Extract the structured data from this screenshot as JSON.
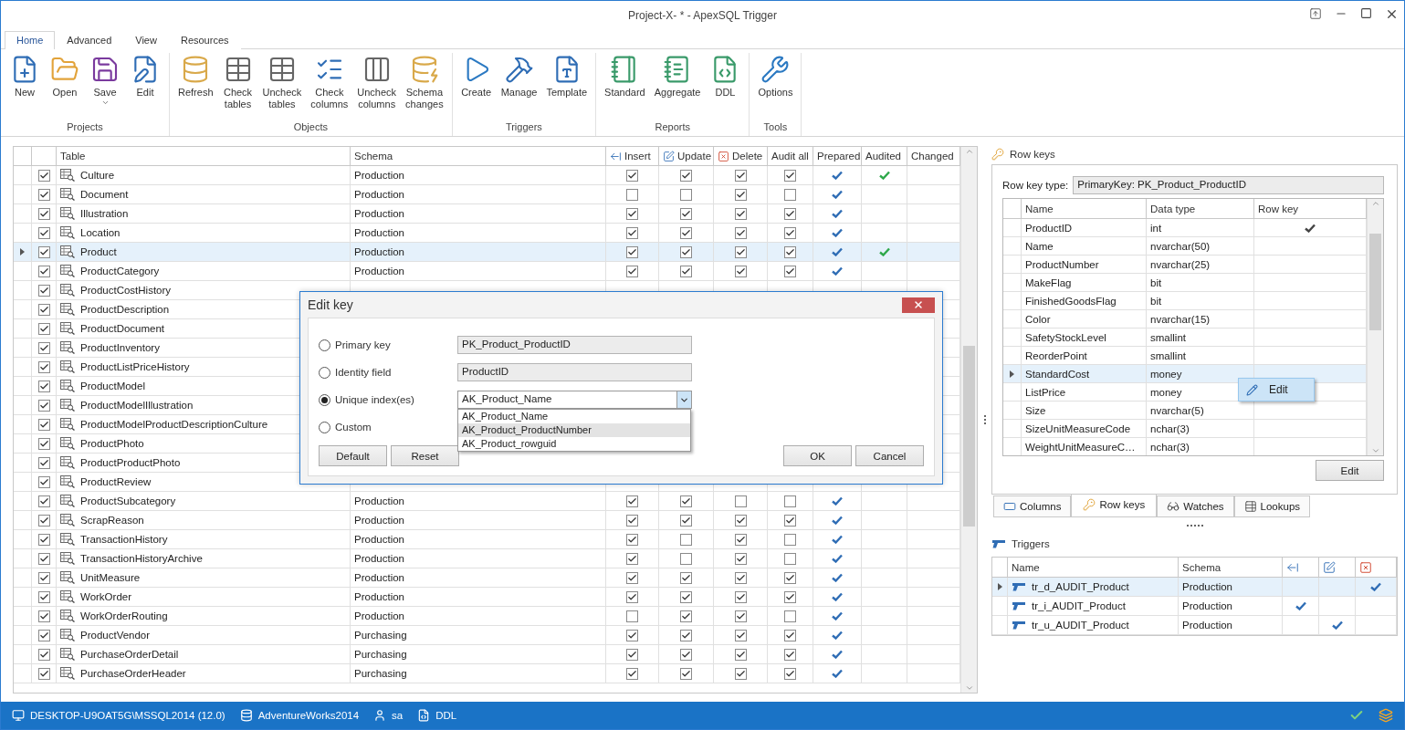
{
  "window": {
    "title": "Project-X- * - ApexSQL Trigger"
  },
  "ribbon_tabs": [
    {
      "label": "Home",
      "selected": true
    },
    {
      "label": "Advanced",
      "selected": false
    },
    {
      "label": "View",
      "selected": false
    },
    {
      "label": "Resources",
      "selected": false
    }
  ],
  "ribbon_groups": [
    {
      "label": "Projects",
      "buttons": [
        {
          "label": "New",
          "kind": "plain"
        },
        {
          "label": "Open",
          "kind": "plain"
        },
        {
          "label": "Save",
          "kind": "dropdown"
        },
        {
          "label": "Edit",
          "kind": "plain"
        }
      ]
    },
    {
      "label": "Objects",
      "buttons": [
        {
          "label": "Refresh",
          "kind": "plain"
        },
        {
          "label": "Check tables",
          "kind": "plain"
        },
        {
          "label": "Uncheck tables",
          "kind": "plain"
        },
        {
          "label": "Check columns",
          "kind": "plain"
        },
        {
          "label": "Uncheck columns",
          "kind": "plain"
        },
        {
          "label": "Schema changes",
          "kind": "plain"
        }
      ]
    },
    {
      "label": "Triggers",
      "buttons": [
        {
          "label": "Create",
          "kind": "plain"
        },
        {
          "label": "Manage",
          "kind": "plain"
        },
        {
          "label": "Template",
          "kind": "plain"
        }
      ]
    },
    {
      "label": "Reports",
      "buttons": [
        {
          "label": "Standard",
          "kind": "plain"
        },
        {
          "label": "Aggregate",
          "kind": "plain"
        },
        {
          "label": "DDL",
          "kind": "plain"
        }
      ]
    },
    {
      "label": "Tools",
      "buttons": [
        {
          "label": "Options",
          "kind": "plain"
        }
      ]
    }
  ],
  "table": {
    "columns": [
      {
        "label": "Table"
      },
      {
        "label": "Schema"
      },
      {
        "label": "Insert"
      },
      {
        "label": "Update"
      },
      {
        "label": "Delete"
      },
      {
        "label": "Audit all"
      },
      {
        "label": "Prepared"
      },
      {
        "label": "Audited"
      },
      {
        "label": "Changed"
      }
    ],
    "rows": [
      {
        "selected": false,
        "included": true,
        "name": "Culture",
        "schema": "Production",
        "insert": true,
        "update": true,
        "delete": true,
        "audit_all": true,
        "prepared": true,
        "audited": true
      },
      {
        "selected": false,
        "included": true,
        "name": "Document",
        "schema": "Production",
        "insert": false,
        "update": false,
        "delete": true,
        "audit_all": false,
        "prepared": true,
        "audited": false
      },
      {
        "selected": false,
        "included": true,
        "name": "Illustration",
        "schema": "Production",
        "insert": true,
        "update": true,
        "delete": true,
        "audit_all": true,
        "prepared": true,
        "audited": false
      },
      {
        "selected": false,
        "included": true,
        "name": "Location",
        "schema": "Production",
        "insert": true,
        "update": true,
        "delete": true,
        "audit_all": true,
        "prepared": true,
        "audited": false
      },
      {
        "selected": true,
        "included": true,
        "name": "Product",
        "schema": "Production",
        "insert": true,
        "update": true,
        "delete": true,
        "audit_all": true,
        "prepared": true,
        "audited": true
      },
      {
        "selected": false,
        "included": true,
        "name": "ProductCategory",
        "schema": "Production",
        "insert": true,
        "update": true,
        "delete": true,
        "audit_all": true,
        "prepared": true,
        "audited": false
      },
      {
        "selected": false,
        "included": true,
        "name": "ProductCostHistory"
      },
      {
        "selected": false,
        "included": true,
        "name": "ProductDescription"
      },
      {
        "selected": false,
        "included": true,
        "name": "ProductDocument"
      },
      {
        "selected": false,
        "included": true,
        "name": "ProductInventory"
      },
      {
        "selected": false,
        "included": true,
        "name": "ProductListPriceHistory"
      },
      {
        "selected": false,
        "included": true,
        "name": "ProductModel"
      },
      {
        "selected": false,
        "included": true,
        "name": "ProductModelIllustration"
      },
      {
        "selected": false,
        "included": true,
        "name": "ProductModelProductDescriptionCulture"
      },
      {
        "selected": false,
        "included": true,
        "name": "ProductPhoto"
      },
      {
        "selected": false,
        "included": true,
        "name": "ProductProductPhoto"
      },
      {
        "selected": false,
        "included": true,
        "name": "ProductReview"
      },
      {
        "selected": false,
        "included": true,
        "name": "ProductSubcategory",
        "schema": "Production",
        "insert": true,
        "update": true,
        "delete": false,
        "audit_all": false,
        "prepared": true,
        "audited": false
      },
      {
        "selected": false,
        "included": true,
        "name": "ScrapReason",
        "schema": "Production",
        "insert": true,
        "update": true,
        "delete": true,
        "audit_all": true,
        "prepared": true,
        "audited": false
      },
      {
        "selected": false,
        "included": true,
        "name": "TransactionHistory",
        "schema": "Production",
        "insert": true,
        "update": false,
        "delete": true,
        "audit_all": false,
        "prepared": true,
        "audited": false
      },
      {
        "selected": false,
        "included": true,
        "name": "TransactionHistoryArchive",
        "schema": "Production",
        "insert": true,
        "update": false,
        "delete": true,
        "audit_all": false,
        "prepared": true,
        "audited": false
      },
      {
        "selected": false,
        "included": true,
        "name": "UnitMeasure",
        "schema": "Production",
        "insert": true,
        "update": true,
        "delete": true,
        "audit_all": true,
        "prepared": true,
        "audited": false
      },
      {
        "selected": false,
        "included": true,
        "name": "WorkOrder",
        "schema": "Production",
        "insert": true,
        "update": true,
        "delete": true,
        "audit_all": true,
        "prepared": true,
        "audited": false
      },
      {
        "selected": false,
        "included": true,
        "name": "WorkOrderRouting",
        "schema": "Production",
        "insert": false,
        "update": true,
        "delete": true,
        "audit_all": false,
        "prepared": true,
        "audited": false
      },
      {
        "selected": false,
        "included": true,
        "name": "ProductVendor",
        "schema": "Purchasing",
        "insert": true,
        "update": true,
        "delete": true,
        "audit_all": true,
        "prepared": true,
        "audited": false
      },
      {
        "selected": false,
        "included": true,
        "name": "PurchaseOrderDetail",
        "schema": "Purchasing",
        "insert": true,
        "update": true,
        "delete": true,
        "audit_all": true,
        "prepared": true,
        "audited": false
      },
      {
        "selected": false,
        "included": true,
        "name": "PurchaseOrderHeader",
        "schema": "Purchasing",
        "insert": true,
        "update": true,
        "delete": true,
        "audit_all": true,
        "prepared": true,
        "audited": false
      }
    ]
  },
  "dialog": {
    "title": "Edit key",
    "options": [
      {
        "label": "Primary key",
        "selected": false,
        "kind": "text",
        "value": "PK_Product_ProductID"
      },
      {
        "label": "Identity field",
        "selected": false,
        "kind": "text",
        "value": "ProductID"
      },
      {
        "label": "Unique index(es)",
        "selected": true,
        "kind": "combo",
        "value": "AK_Product_Name",
        "items": [
          {
            "label": "AK_Product_Name",
            "highlighted": false
          },
          {
            "label": "AK_Product_ProductNumber",
            "highlighted": true
          },
          {
            "label": "AK_Product_rowguid",
            "highlighted": false
          }
        ]
      },
      {
        "label": "Custom",
        "selected": false,
        "kind": "none"
      }
    ],
    "left_buttons": [
      "Default",
      "Reset"
    ],
    "right_buttons": [
      "OK",
      "Cancel"
    ]
  },
  "row_keys": {
    "title": "Row keys",
    "key_type_label": "Row key type:",
    "key_type_value": "PrimaryKey: PK_Product_ProductID",
    "columns": [
      "Name",
      "Data type",
      "Row key"
    ],
    "rows": [
      {
        "name": "ProductID",
        "data_type": "int",
        "row_key": true,
        "selected": false
      },
      {
        "name": "Name",
        "data_type": "nvarchar(50)",
        "row_key": false,
        "selected": false
      },
      {
        "name": "ProductNumber",
        "data_type": "nvarchar(25)",
        "row_key": false,
        "selected": false
      },
      {
        "name": "MakeFlag",
        "data_type": "bit",
        "row_key": false,
        "selected": false
      },
      {
        "name": "FinishedGoodsFlag",
        "data_type": "bit",
        "row_key": false,
        "selected": false
      },
      {
        "name": "Color",
        "data_type": "nvarchar(15)",
        "row_key": false,
        "selected": false
      },
      {
        "name": "SafetyStockLevel",
        "data_type": "smallint",
        "row_key": false,
        "selected": false
      },
      {
        "name": "ReorderPoint",
        "data_type": "smallint",
        "row_key": false,
        "selected": false
      },
      {
        "name": "StandardCost",
        "data_type": "money",
        "row_key": false,
        "selected": true
      },
      {
        "name": "ListPrice",
        "data_type": "money",
        "row_key": false,
        "selected": false
      },
      {
        "name": "Size",
        "data_type": "nvarchar(5)",
        "row_key": false,
        "selected": false
      },
      {
        "name": "SizeUnitMeasureCode",
        "data_type": "nchar(3)",
        "row_key": false,
        "selected": false
      },
      {
        "name": "WeightUnitMeasureC…",
        "data_type": "nchar(3)",
        "row_key": false,
        "selected": false
      }
    ],
    "context_menu": {
      "label": "Edit"
    },
    "edit_button": "Edit"
  },
  "panel_tabs": [
    {
      "label": "Columns",
      "selected": false
    },
    {
      "label": "Row keys",
      "selected": true
    },
    {
      "label": "Watches",
      "selected": false
    },
    {
      "label": "Lookups",
      "selected": false
    }
  ],
  "triggers": {
    "title": "Triggers",
    "columns": [
      "Name",
      "Schema"
    ],
    "rows": [
      {
        "name": "tr_d_AUDIT_Product",
        "schema": "Production",
        "insert": false,
        "update": false,
        "delete": true,
        "selected": true
      },
      {
        "name": "tr_i_AUDIT_Product",
        "schema": "Production",
        "insert": true,
        "update": false,
        "delete": false,
        "selected": false
      },
      {
        "name": "tr_u_AUDIT_Product",
        "schema": "Production",
        "insert": false,
        "update": true,
        "delete": false,
        "selected": false
      }
    ]
  },
  "status_bar": {
    "items": [
      "DESKTOP-U9OAT5G\\MSSQL2014 (12.0)",
      "AdventureWorks2014",
      "sa",
      "DDL"
    ]
  }
}
